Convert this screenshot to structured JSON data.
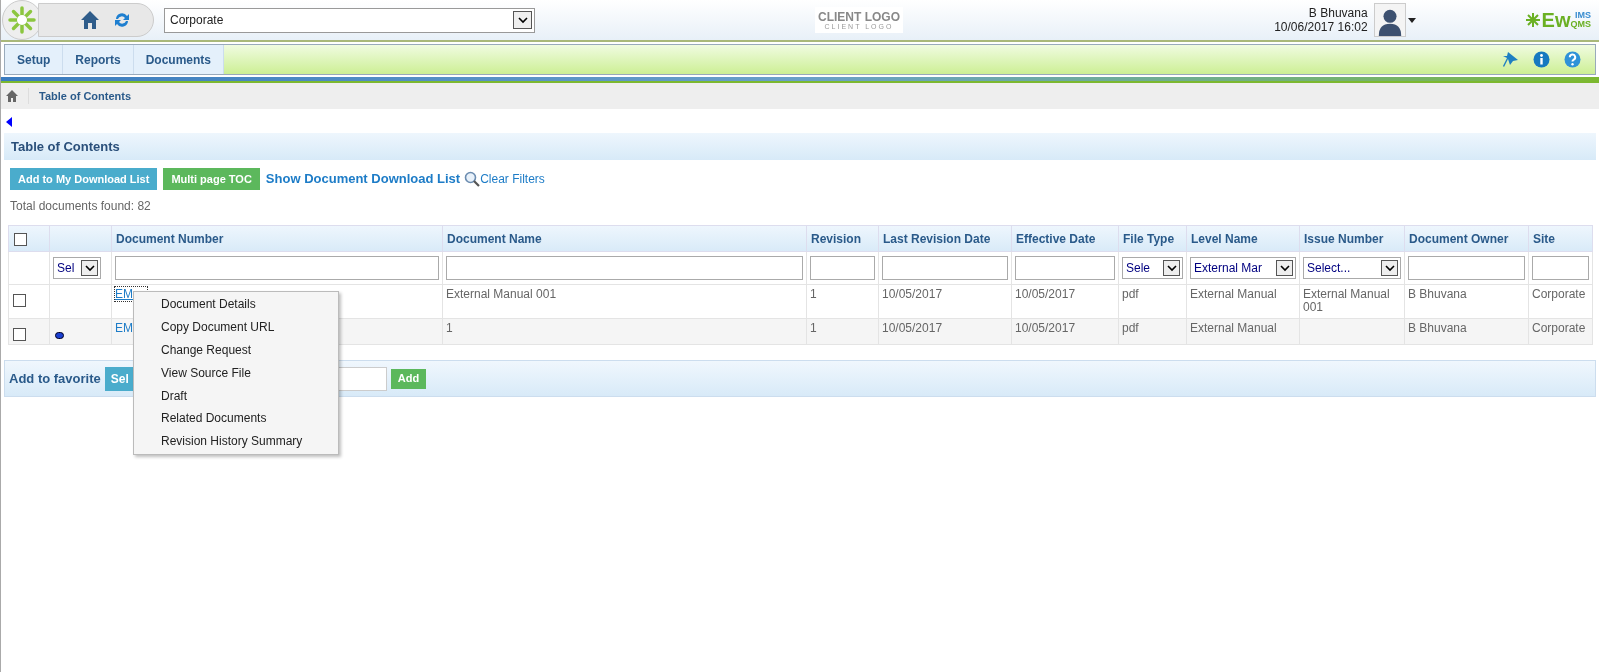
{
  "header": {
    "location_select": "Corporate",
    "client_logo": "CLIENT LOGO",
    "client_logo_sub": "CLIENT LOGO",
    "user_name": "B Bhuvana",
    "datetime": "10/06/2017 16:02",
    "brand": "Ew",
    "brand_sup": "IMS",
    "brand_sub": "QMS"
  },
  "menu": [
    {
      "label": "Setup",
      "selected": false
    },
    {
      "label": "Reports",
      "selected": false
    },
    {
      "label": "Documents",
      "selected": false
    }
  ],
  "breadcrumb": "Table of Contents",
  "panel_title": "Table of Contents",
  "actions": {
    "add_download": "Add to My Download List",
    "multi_toc": "Multi page TOC",
    "show_download": "Show Document Download List",
    "clear_filters": "Clear Filters"
  },
  "total": "Total documents found: 82",
  "table": {
    "columns": [
      "Document Number",
      "Document Name",
      "Revision",
      "Last Revision Date",
      "Effective Date",
      "File Type",
      "Level Name",
      "Issue Number",
      "Document Owner",
      "Site"
    ],
    "select_all_checked": false,
    "status_filter": "Sel",
    "filters": [
      {
        "kind": "text"
      },
      {
        "kind": "text"
      },
      {
        "kind": "text"
      },
      {
        "kind": "text"
      },
      {
        "kind": "text"
      },
      {
        "kind": "select",
        "value": "Sele"
      },
      {
        "kind": "select",
        "value": "External Mar"
      },
      {
        "kind": "select",
        "value": "Select..."
      },
      {
        "kind": "text"
      },
      {
        "kind": "text"
      }
    ],
    "rows": [
      {
        "checked": false,
        "dot": false,
        "focused": true,
        "cells": [
          "EM",
          "External Manual 001",
          "1",
          "10/05/2017",
          "10/05/2017",
          "pdf",
          "External Manual",
          "External Manual 001",
          "B Bhuvana",
          "Corporate"
        ]
      },
      {
        "checked": false,
        "dot": true,
        "focused": false,
        "cells": [
          "EM",
          "1",
          "1",
          "10/05/2017",
          "10/05/2017",
          "pdf",
          "External Manual",
          "",
          "B Bhuvana",
          "Corporate"
        ]
      }
    ]
  },
  "favorite": {
    "label": "Add to favorite",
    "select": "Sel",
    "add": "Add"
  },
  "context_menu": [
    "Document Details",
    "Copy Document URL",
    "Change Request",
    "View Source File",
    "Draft",
    "Related Documents",
    "Revision History Summary"
  ]
}
